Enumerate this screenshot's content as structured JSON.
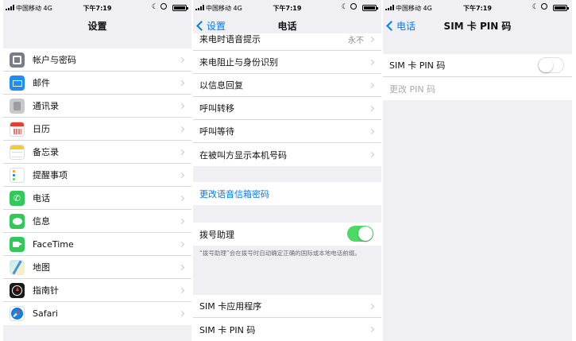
{
  "status_bar": {
    "carrier": "中国移动 4G",
    "time": "下午7:19"
  },
  "settings": {
    "title": "设置",
    "items": [
      {
        "label": "帐户与密码",
        "icon": "accounts-icon"
      },
      {
        "label": "邮件",
        "icon": "mail-icon"
      },
      {
        "label": "通讯录",
        "icon": "contacts-icon"
      },
      {
        "label": "日历",
        "icon": "calendar-icon"
      },
      {
        "label": "备忘录",
        "icon": "notes-icon"
      },
      {
        "label": "提醒事项",
        "icon": "reminders-icon"
      },
      {
        "label": "电话",
        "icon": "phone-icon"
      },
      {
        "label": "信息",
        "icon": "messages-icon"
      },
      {
        "label": "FaceTime",
        "icon": "facetime-icon"
      },
      {
        "label": "地图",
        "icon": "maps-icon"
      },
      {
        "label": "指南针",
        "icon": "compass-icon"
      },
      {
        "label": "Safari",
        "icon": "safari-icon"
      }
    ]
  },
  "phone": {
    "back": "设置",
    "title": "电话",
    "group1": [
      {
        "label": "来电时语音提示",
        "value": "永不"
      },
      {
        "label": "来电阻止与身份识别"
      },
      {
        "label": "以信息回复"
      },
      {
        "label": "呼叫转移"
      },
      {
        "label": "呼叫等待"
      },
      {
        "label": "在被叫方显示本机号码"
      }
    ],
    "voicemail_link": "更改语音信箱密码",
    "dial_assist": {
      "label": "拨号助理",
      "on": true
    },
    "dial_assist_note": "“拨号助理”会在拨号时自动确定正确的国际或本地电话前缀。",
    "group3": [
      {
        "label": "SIM 卡应用程序"
      },
      {
        "label": "SIM 卡 PIN 码"
      }
    ]
  },
  "sim_pin": {
    "back": "电话",
    "title": "SIM 卡 PIN 码",
    "toggle_label": "SIM 卡 PIN 码",
    "toggle_on": false,
    "change_label": "更改 PIN 码"
  },
  "colors": {
    "accent": "#007aff",
    "toggle_on": "#4cd964",
    "background": "#efeff4"
  }
}
